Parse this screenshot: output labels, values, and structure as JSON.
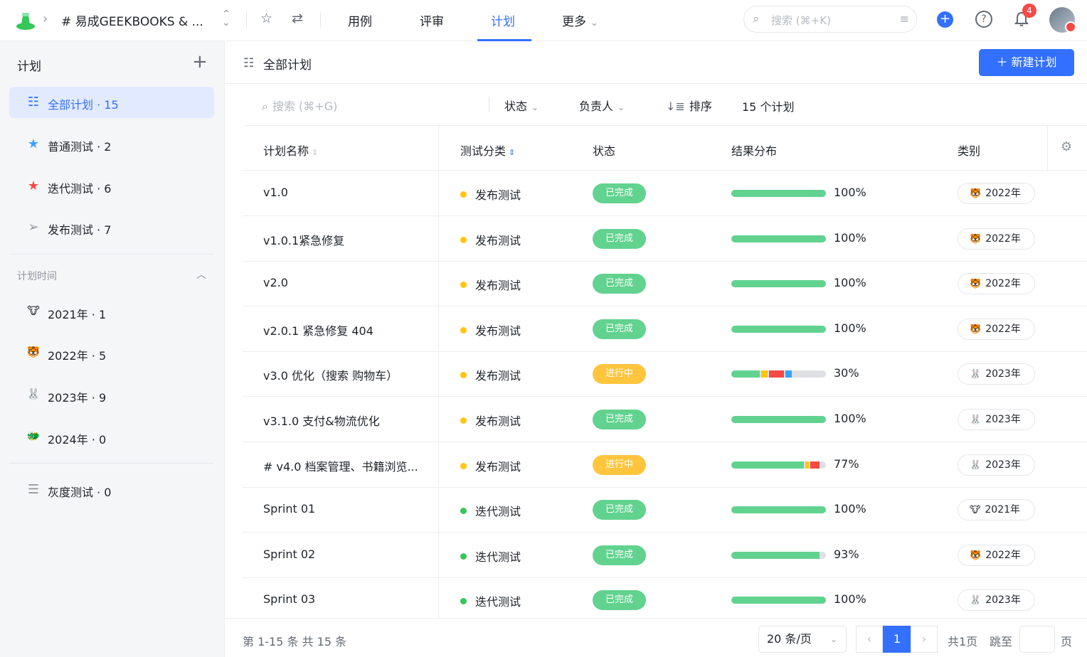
{
  "topbar": {
    "project_name": "# 易成GEEKBOOKS & ...",
    "tabs": [
      {
        "label": "用例",
        "active": false
      },
      {
        "label": "评审",
        "active": false
      },
      {
        "label": "计划",
        "active": true
      },
      {
        "label": "更多",
        "active": false
      }
    ],
    "search_placeholder": "搜索 (⌘+K)",
    "notification_count": "4",
    "accent_color": "#3370ff"
  },
  "sidebar": {
    "title": "计划",
    "items": [
      {
        "label": "全部计划 · 15",
        "icon": "list-icon",
        "active": true
      },
      {
        "label": "普通测试 · 2",
        "icon": "star-icon",
        "active": false
      },
      {
        "label": "迭代测试 · 6",
        "icon": "star-icon",
        "active": false
      },
      {
        "label": "发布测试 · 7",
        "icon": "send-icon",
        "active": false
      }
    ],
    "time_section": "计划时间",
    "years": [
      {
        "label": "2021年 · 1",
        "icon": "ox-icon"
      },
      {
        "label": "2022年 · 5",
        "icon": "tiger-icon"
      },
      {
        "label": "2023年 · 9",
        "icon": "rabbit-icon"
      },
      {
        "label": "2024年 · 0",
        "icon": "dragon-icon"
      }
    ],
    "gray_item": {
      "label": "灰度测试 · 0",
      "icon": "checklist-icon"
    }
  },
  "main": {
    "title": "全部计划",
    "new_button": "新建计划",
    "search_placeholder": "搜索 (⌘+G)",
    "filters": {
      "status": "状态",
      "owner": "负责人",
      "sort": "排序"
    },
    "count_text": "15 个计划",
    "columns": {
      "name": "计划名称",
      "category": "测试分类",
      "status": "状态",
      "result": "结果分布",
      "type": "类别"
    },
    "rows": [
      {
        "name": "v1.0",
        "category": "发布测试",
        "cat_color": "#ffc60a",
        "status": "已完成",
        "status_color": "#62d28f",
        "result_pct": "100%",
        "result_fraction": 1.0,
        "segments": [
          {
            "color": "#62d28f",
            "frac": 1.0
          }
        ],
        "year": "2022年",
        "year_icon": "tiger-icon"
      },
      {
        "name": "v1.0.1紧急修复",
        "category": "发布测试",
        "cat_color": "#ffc60a",
        "status": "已完成",
        "status_color": "#62d28f",
        "result_pct": "100%",
        "result_fraction": 1.0,
        "segments": [
          {
            "color": "#62d28f",
            "frac": 1.0
          }
        ],
        "year": "2022年",
        "year_icon": "tiger-icon"
      },
      {
        "name": "v2.0",
        "category": "发布测试",
        "cat_color": "#ffc60a",
        "status": "已完成",
        "status_color": "#62d28f",
        "result_pct": "100%",
        "result_fraction": 1.0,
        "segments": [
          {
            "color": "#62d28f",
            "frac": 1.0
          }
        ],
        "year": "2022年",
        "year_icon": "tiger-icon"
      },
      {
        "name": "v2.0.1 紧急修复 404",
        "category": "发布测试",
        "cat_color": "#ffc60a",
        "status": "已完成",
        "status_color": "#62d28f",
        "result_pct": "100%",
        "result_fraction": 1.0,
        "segments": [
          {
            "color": "#62d28f",
            "frac": 1.0
          }
        ],
        "year": "2022年",
        "year_icon": "tiger-icon"
      },
      {
        "name": "v3.0 优化（搜索 购物车）",
        "category": "发布测试",
        "cat_color": "#ffc60a",
        "status": "进行中",
        "status_color": "#ffc53d",
        "result_pct": "30%",
        "result_fraction": 0.3,
        "segments": [
          {
            "color": "#62d28f",
            "frac": 0.3
          },
          {
            "color": "#ffc60a",
            "frac": 0.07
          },
          {
            "color": "#f54a45",
            "frac": 0.16
          },
          {
            "color": "#3ba1ff",
            "frac": 0.07
          }
        ],
        "year": "2023年",
        "year_icon": "rabbit-icon"
      },
      {
        "name": "v3.1.0 支付&物流优化",
        "category": "发布测试",
        "cat_color": "#ffc60a",
        "status": "已完成",
        "status_color": "#62d28f",
        "result_pct": "100%",
        "result_fraction": 1.0,
        "segments": [
          {
            "color": "#62d28f",
            "frac": 1.0
          }
        ],
        "year": "2023年",
        "year_icon": "rabbit-icon"
      },
      {
        "name": "# v4.0 档案管理、书籍浏览...",
        "category": "发布测试",
        "cat_color": "#ffc60a",
        "status": "进行中",
        "status_color": "#ffc53d",
        "result_pct": "77%",
        "result_fraction": 0.77,
        "segments": [
          {
            "color": "#62d28f",
            "frac": 0.77
          },
          {
            "color": "#ffc60a",
            "frac": 0.04
          },
          {
            "color": "#f54a45",
            "frac": 0.1
          }
        ],
        "year": "2023年",
        "year_icon": "rabbit-icon"
      },
      {
        "name": "Sprint 01",
        "category": "迭代测试",
        "cat_color": "#34c759",
        "status": "已完成",
        "status_color": "#62d28f",
        "result_pct": "100%",
        "result_fraction": 1.0,
        "segments": [
          {
            "color": "#62d28f",
            "frac": 1.0
          }
        ],
        "year": "2021年",
        "year_icon": "ox-icon"
      },
      {
        "name": "Sprint 02",
        "category": "迭代测试",
        "cat_color": "#34c759",
        "status": "已完成",
        "status_color": "#62d28f",
        "result_pct": "93%",
        "result_fraction": 0.93,
        "segments": [
          {
            "color": "#62d28f",
            "frac": 0.93
          }
        ],
        "year": "2022年",
        "year_icon": "tiger-icon"
      },
      {
        "name": "Sprint 03",
        "category": "迭代测试",
        "cat_color": "#34c759",
        "status": "已完成",
        "status_color": "#62d28f",
        "result_pct": "100%",
        "result_fraction": 1.0,
        "segments": [
          {
            "color": "#62d28f",
            "frac": 1.0
          }
        ],
        "year": "2023年",
        "year_icon": "rabbit-icon"
      }
    ],
    "footer": {
      "range_text": "第 1-15 条  共 15 条",
      "page_size": "20 条/页",
      "current_page": "1",
      "total_pages": "共1页",
      "jump_label": "跳至",
      "page_suffix": "页"
    }
  }
}
